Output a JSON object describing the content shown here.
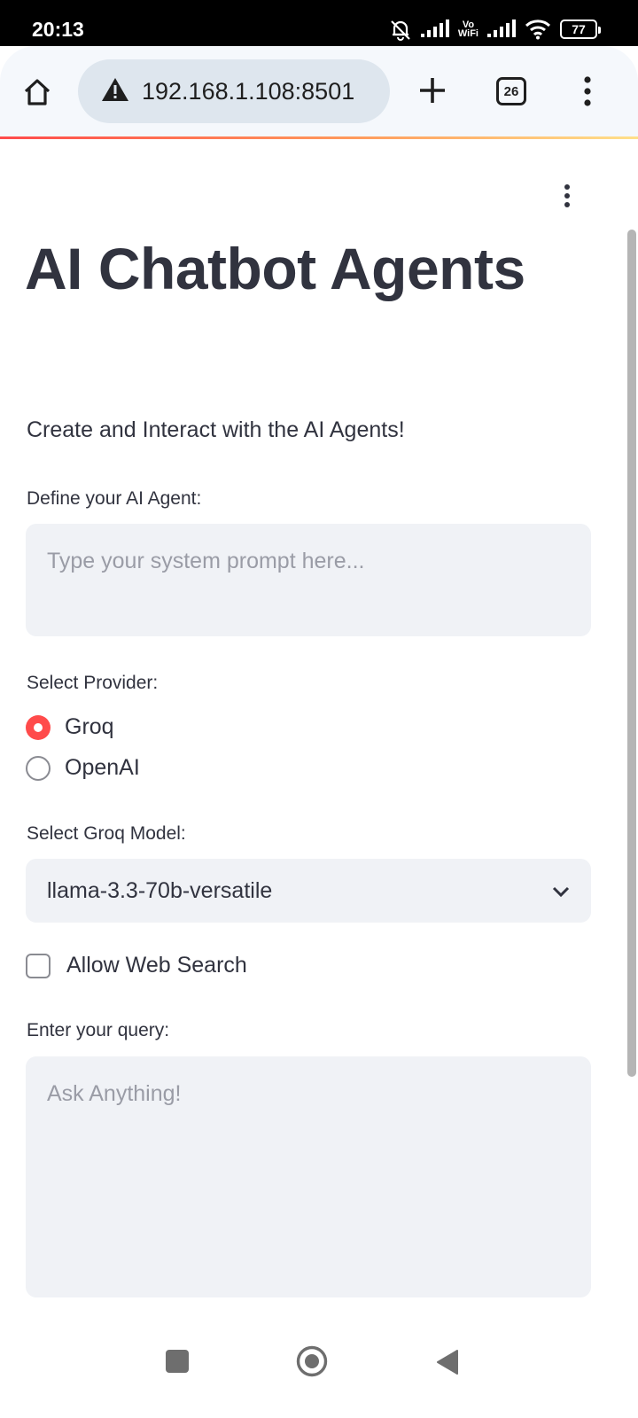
{
  "status_bar": {
    "time": "20:13",
    "vowifi_top": "Vo",
    "vowifi_bottom": "WiFi",
    "battery": "77",
    "icons": [
      "mute-bell-icon",
      "signal-icon",
      "vowifi-icon",
      "signal-icon",
      "wifi-icon",
      "battery-icon"
    ]
  },
  "browser": {
    "url": "192.168.1.108:8501",
    "tab_count": "26",
    "icons": [
      "home-icon",
      "not-secure-warning-icon",
      "new-tab-plus-icon",
      "tabs-icon",
      "menu-kebab-icon"
    ],
    "progress_gradient": [
      "#ff4b4b",
      "#ff9a5c",
      "#ffe08a"
    ]
  },
  "app": {
    "title": "AI Chatbot Agents",
    "subtitle": "Create and Interact with the AI Agents!",
    "system_prompt": {
      "label": "Define your AI Agent:",
      "placeholder": "Type your system prompt here...",
      "value": ""
    },
    "provider": {
      "label": "Select Provider:",
      "options": [
        "Groq",
        "OpenAI"
      ],
      "selected": "Groq"
    },
    "model": {
      "label": "Select Groq Model:",
      "selected": "llama-3.3-70b-versatile"
    },
    "web_search": {
      "label": "Allow Web Search",
      "checked": false
    },
    "query": {
      "label": "Enter your query:",
      "placeholder": "Ask Anything!",
      "value": ""
    },
    "accent_color": "#ff4b4b",
    "text_color": "#31333f",
    "input_bg": "#f0f2f6"
  },
  "nav_bar": {
    "icons": [
      "recents-square-icon",
      "home-circle-icon",
      "back-triangle-icon"
    ]
  }
}
